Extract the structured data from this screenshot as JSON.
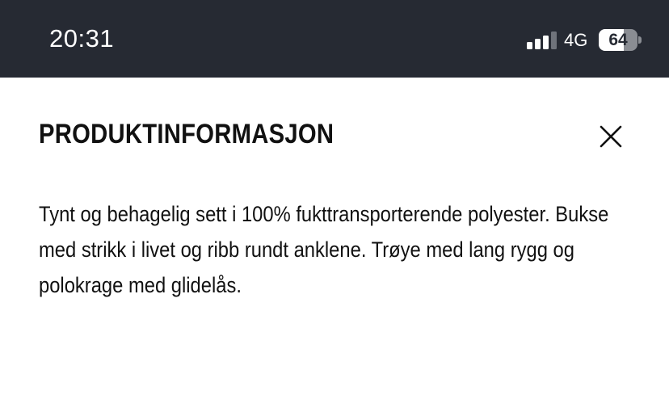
{
  "status_bar": {
    "time": "20:31",
    "network": "4G",
    "signal_bars_active": 3,
    "signal_bars_total": 4,
    "battery": "64",
    "battery_level_percent": 64
  },
  "sheet": {
    "title": "PRODUKTINFORMASJON",
    "close_icon": "close-icon",
    "description": "Tynt og behagelig sett i 100% fukttransporterende polyester. Bukse med strikk i livet og ribb rundt anklene. Trøye med lang rygg og polokrage med glidelås."
  },
  "colors": {
    "status_bar_bg": "#262a33",
    "page_bg": "#ffffff",
    "text": "#111111"
  }
}
